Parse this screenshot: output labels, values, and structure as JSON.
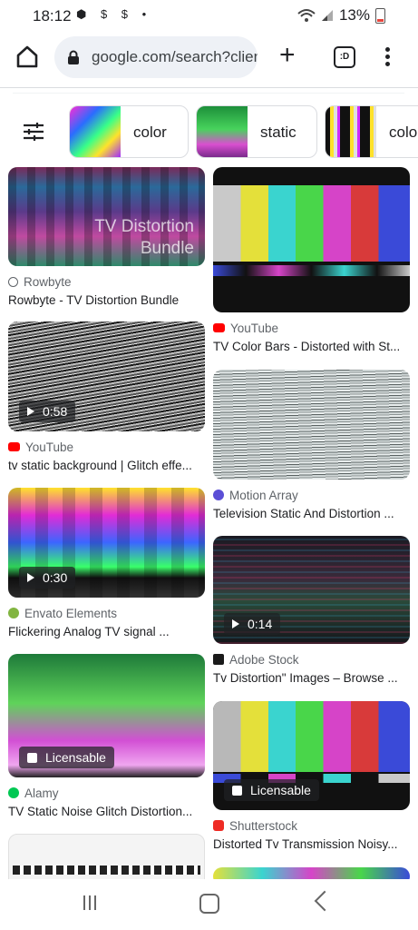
{
  "status_bar": {
    "time": "18:12",
    "left_icons": "⬢ $ $ •",
    "battery": "13%"
  },
  "browser": {
    "url": "google.com/search?client",
    "tab_count": ":D"
  },
  "chips": [
    {
      "label": "color"
    },
    {
      "label": "static"
    },
    {
      "label": "colo"
    }
  ],
  "results": [
    {
      "source": "Rowbyte",
      "title": "Rowbyte - TV Distortion Bundle",
      "overlay": "TV Distortion Bundle",
      "badge": ""
    },
    {
      "source": "YouTube",
      "title": "TV Color Bars - Distorted with St...",
      "badge": ""
    },
    {
      "source": "YouTube",
      "title": "tv static background | Glitch effe...",
      "badge": "0:58"
    },
    {
      "source": "Motion Array",
      "title": "Television Static And Distortion ...",
      "badge": ""
    },
    {
      "source": "Envato Elements",
      "title": "Flickering Analog TV signal ...",
      "badge": "0:30"
    },
    {
      "source": "Adobe Stock",
      "title": "Tv Distortion\" Images – Browse ...",
      "badge": "0:14"
    },
    {
      "source": "Alamy",
      "title": "TV Static Noise Glitch Distortion...",
      "badge": "Licensable"
    },
    {
      "source": "Shutterstock",
      "title": "Distorted Tv Transmission Noisy...",
      "badge": "Licensable"
    }
  ],
  "source_icons": {
    "Rowbyte": "globe-icon",
    "YouTube": "youtube-icon",
    "Motion Array": "motion-array-icon",
    "Envato Elements": "envato-icon",
    "Adobe Stock": "adobe-stock-icon",
    "Alamy": "alamy-icon",
    "Shutterstock": "shutterstock-icon"
  },
  "colors": {
    "youtube": "#ff0000",
    "accent": "#1a73e8",
    "envato": "#82b541",
    "shutterstock": "#ee2b24",
    "alamy": "#00c853"
  }
}
